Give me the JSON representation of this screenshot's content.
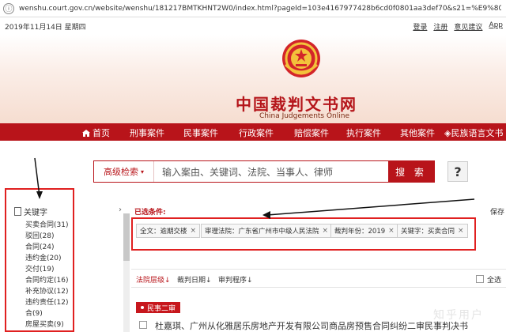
{
  "browser": {
    "url": "wenshu.court.gov.cn/website/wenshu/181217BMTKHNT2W0/index.html?pageId=103e4167977428b6cd0f0801aa3def70&s21=%E9%80%BE%E6%9C%9F%E4%BA%A4..."
  },
  "topbar": {
    "date": "2019年11月14日 星期四",
    "links": [
      "登录",
      "注册",
      "意见建议",
      "App"
    ]
  },
  "header": {
    "title": "中国裁判文书网",
    "subtitle": "China Judgements Online"
  },
  "nav": {
    "items": [
      "首页",
      "刑事案件",
      "民事案件",
      "行政案件",
      "赔偿案件",
      "执行案件",
      "其他案件",
      "民族语言文书"
    ]
  },
  "search": {
    "advanced_label": "高级检索",
    "placeholder": "输入案由、关键词、法院、当事人、律师",
    "button_label": "搜 索",
    "help_label": "?"
  },
  "sidebar": {
    "title": "关键字",
    "items": [
      "买卖合同(31)",
      "驳回(28)",
      "合同(24)",
      "违约金(20)",
      "交付(19)",
      "合同约定(16)",
      "补充协议(12)",
      "违约责任(12)",
      "合(9)",
      "房屋买卖(9)"
    ]
  },
  "conditions": {
    "label": "已选条件:",
    "save_label": "保存",
    "tags": [
      "全文：逾期交楼",
      "审理法院：广东省广州市中级人民法院",
      "裁判年份：2019",
      "关键字：买卖合同"
    ]
  },
  "sort": {
    "court_level": "法院层级",
    "judge_date": "裁判日期",
    "procedure": "审判程序",
    "select_all": "全选"
  },
  "results": {
    "category": "民事二审",
    "first_title": "杜嘉琪、广州从化雅居乐房地产开发有限公司商品房预售合同纠纷二审民事判决书"
  },
  "watermark": "知乎用户",
  "colors": {
    "brand_red": "#b8141a",
    "annotation_red": "#e02020"
  }
}
